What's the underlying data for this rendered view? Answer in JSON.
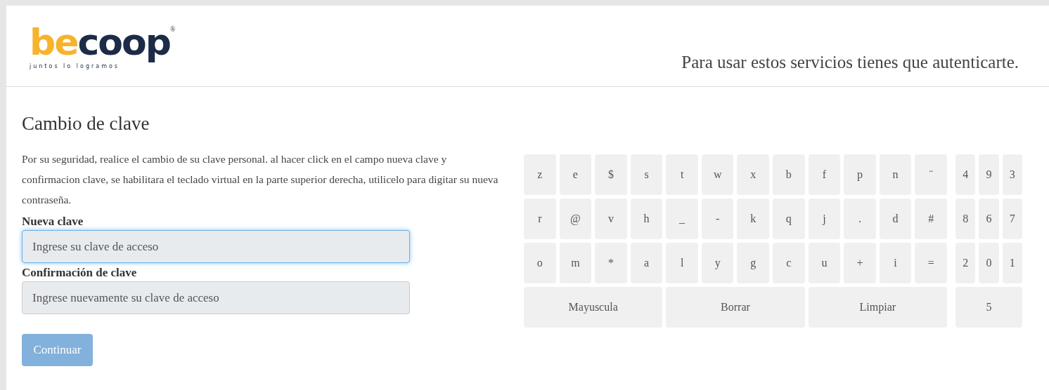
{
  "header": {
    "logo": {
      "wordmark": "becoop",
      "registered": "®",
      "tagline": "juntos lo logramos"
    },
    "notice": "Para usar estos servicios tienes que autenticarte."
  },
  "form": {
    "title": "Cambio de clave",
    "instructions": "Por su seguridad, realice el cambio de su clave personal. al hacer click en el campo nueva clave y confirmacion clave, se habilitara el teclado virtual en la parte superior derecha, utilicelo para digitar su nueva contraseña.",
    "fields": [
      {
        "label": "Nueva clave",
        "placeholder": "Ingrese su clave de acceso",
        "focused": true
      },
      {
        "label": "Confirmación de clave",
        "placeholder": "Ingrese nuevamente su clave de acceso",
        "focused": false
      }
    ],
    "submit": {
      "label": "Continuar",
      "disabled": true
    }
  },
  "keyboard": {
    "rows": [
      {
        "letters": [
          "z",
          "e",
          "$",
          "s",
          "t",
          "w",
          "x",
          "b",
          "f",
          "p",
          "n",
          "¨"
        ],
        "digits": [
          "4",
          "9",
          "3"
        ]
      },
      {
        "letters": [
          "r",
          "@",
          "v",
          "h",
          "_",
          "-",
          "k",
          "q",
          "j",
          ".",
          "d",
          "#"
        ],
        "digits": [
          "8",
          "6",
          "7"
        ]
      },
      {
        "letters": [
          "o",
          "m",
          "*",
          "a",
          "l",
          "y",
          "g",
          "c",
          "u",
          "+",
          "i",
          "="
        ],
        "digits": [
          "2",
          "0",
          "1"
        ]
      }
    ],
    "actions": [
      "Mayuscula",
      "Borrar",
      "Limpiar"
    ],
    "last_digit": "5"
  }
}
